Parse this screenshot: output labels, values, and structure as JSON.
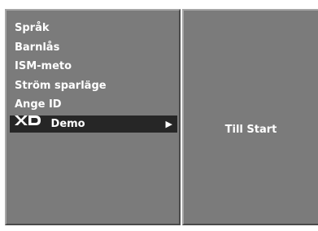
{
  "menu": {
    "items": [
      {
        "label": "Språk"
      },
      {
        "label": "Barnlås"
      },
      {
        "label": "ISM-meto"
      },
      {
        "label": "Ström sparläge"
      },
      {
        "label": "Ange ID"
      },
      {
        "label": "Demo",
        "logo": "XD",
        "selected": true
      }
    ]
  },
  "submenu": {
    "label": "Till Start"
  },
  "colors": {
    "panel": "#7b7b7b",
    "highlight": "#262626",
    "text": "#ffffff"
  },
  "icons": {
    "selected_arrow": "right-triangle-icon",
    "brand": "xd-logo-icon"
  }
}
